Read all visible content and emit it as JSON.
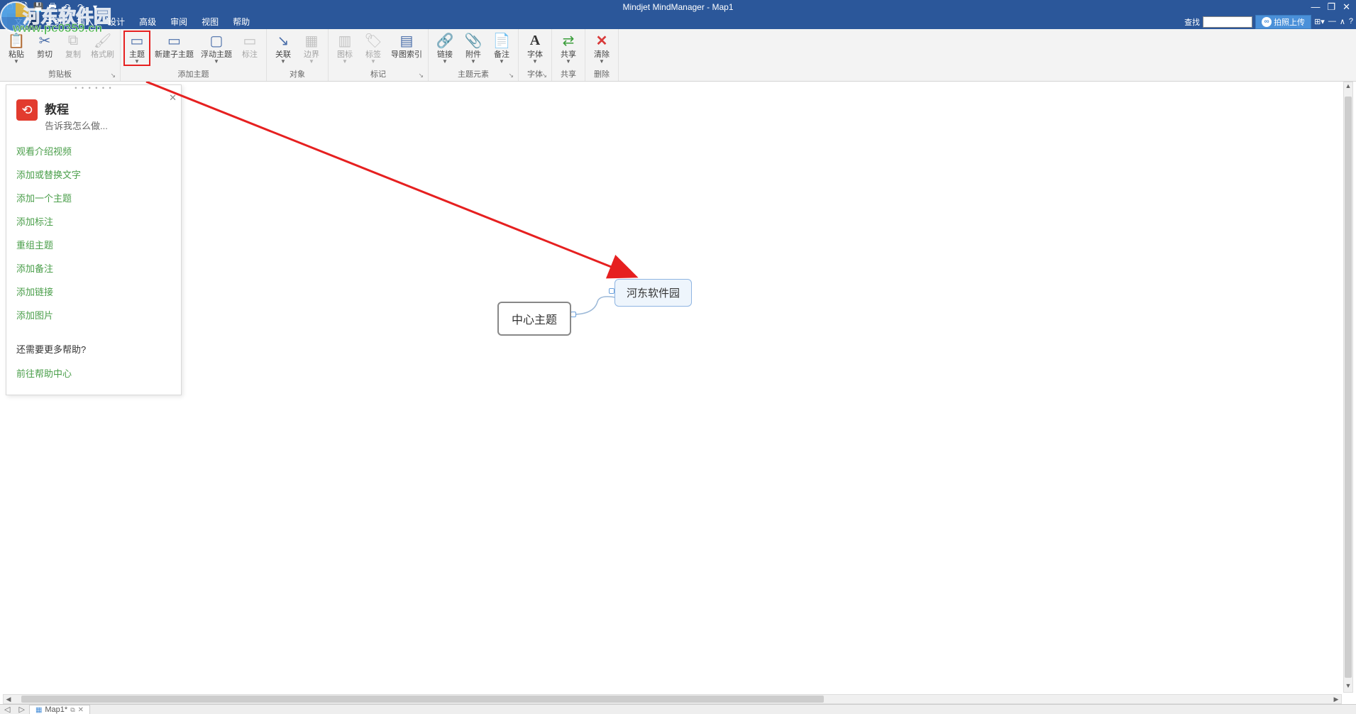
{
  "app": {
    "title": "Mindjet MindManager - Map1"
  },
  "qat": [
    "🗅",
    "🗎",
    "💾",
    "🖶",
    "↶",
    "↷",
    "▾"
  ],
  "window_controls": [
    "—",
    "❐",
    "✕"
  ],
  "menubar": {
    "search_label": "查找",
    "upload_label": "拍照上传",
    "tabs": [
      {
        "label": "文件",
        "file": true
      },
      {
        "label": "主页"
      },
      {
        "label": "插入"
      },
      {
        "label": "设计"
      },
      {
        "label": "高级"
      },
      {
        "label": "审阅"
      },
      {
        "label": "视图"
      },
      {
        "label": "帮助"
      }
    ]
  },
  "ribbon": {
    "groups": [
      {
        "name": "clipboard",
        "label": "剪贴板",
        "launcher": true,
        "buttons": [
          {
            "id": "paste",
            "label": "粘贴",
            "dd": true,
            "icon": "📋",
            "cls": "paste"
          },
          {
            "id": "cut",
            "label": "剪切",
            "icon": "✂",
            "cls": "cut"
          },
          {
            "id": "copy",
            "label": "复制",
            "icon": "⧉",
            "cls": "copy",
            "disabled": true
          },
          {
            "id": "format-painter",
            "label": "格式刷",
            "icon": "🖌",
            "cls": "brush",
            "disabled": true
          }
        ]
      },
      {
        "name": "add-topic",
        "label": "添加主题",
        "buttons": [
          {
            "id": "topic",
            "label": "主题",
            "dd": true,
            "icon": "▭",
            "cls": "topic",
            "highlight": true
          },
          {
            "id": "subtopic",
            "label": "新建子主题",
            "icon": "▭",
            "cls": "subtopic"
          },
          {
            "id": "floating",
            "label": "浮动主题",
            "dd": true,
            "icon": "▢",
            "cls": "float"
          },
          {
            "id": "callout",
            "label": "标注",
            "icon": "▭",
            "cls": "callout",
            "disabled": true
          }
        ]
      },
      {
        "name": "object",
        "label": "对象",
        "buttons": [
          {
            "id": "relationship",
            "label": "关联",
            "dd": true,
            "icon": "↘",
            "cls": "relate"
          },
          {
            "id": "boundary",
            "label": "边界",
            "dd": true,
            "icon": "▦",
            "cls": "boundary",
            "disabled": true
          }
        ]
      },
      {
        "name": "markers",
        "label": "标记",
        "launcher": true,
        "buttons": [
          {
            "id": "icons",
            "label": "图标",
            "dd": true,
            "icon": "▥",
            "cls": "icons",
            "disabled": true
          },
          {
            "id": "tags",
            "label": "标签",
            "dd": true,
            "icon": "🏷",
            "cls": "tag",
            "disabled": true
          },
          {
            "id": "map-index",
            "label": "导图索引",
            "icon": "▤",
            "cls": "index"
          }
        ]
      },
      {
        "name": "topic-elements",
        "label": "主题元素",
        "launcher": true,
        "buttons": [
          {
            "id": "hyperlink",
            "label": "链接",
            "dd": true,
            "icon": "🔗",
            "cls": "link"
          },
          {
            "id": "attachment",
            "label": "附件",
            "dd": true,
            "icon": "📎",
            "cls": "attach"
          },
          {
            "id": "notes",
            "label": "备注",
            "dd": true,
            "icon": "📄",
            "cls": "note"
          }
        ]
      },
      {
        "name": "font",
        "label": "字体",
        "launcher": true,
        "buttons": [
          {
            "id": "font",
            "label": "字体",
            "dd": true,
            "icon": "A",
            "cls": "font"
          }
        ]
      },
      {
        "name": "share",
        "label": "共享",
        "buttons": [
          {
            "id": "share",
            "label": "共享",
            "dd": true,
            "icon": "⇄",
            "cls": "share"
          }
        ]
      },
      {
        "name": "delete",
        "label": "删除",
        "buttons": [
          {
            "id": "clear",
            "label": "清除",
            "dd": true,
            "icon": "✕",
            "cls": "clear"
          }
        ]
      }
    ]
  },
  "panel": {
    "title": "教程",
    "subtitle": "告诉我怎么做...",
    "links": [
      "观看介绍视频",
      "添加或替换文字",
      "添加一个主题",
      "添加标注",
      "重组主题",
      "添加备注",
      "添加链接",
      "添加图片"
    ],
    "more_header": "还需要更多帮助?",
    "more_link": "前往帮助中心"
  },
  "map": {
    "center_label": "中心主题",
    "sub_label": "河东软件园"
  },
  "doctab": {
    "name": "Map1*"
  },
  "watermark": {
    "brand": "河东软件园",
    "url": "www.pc0359.cn"
  }
}
